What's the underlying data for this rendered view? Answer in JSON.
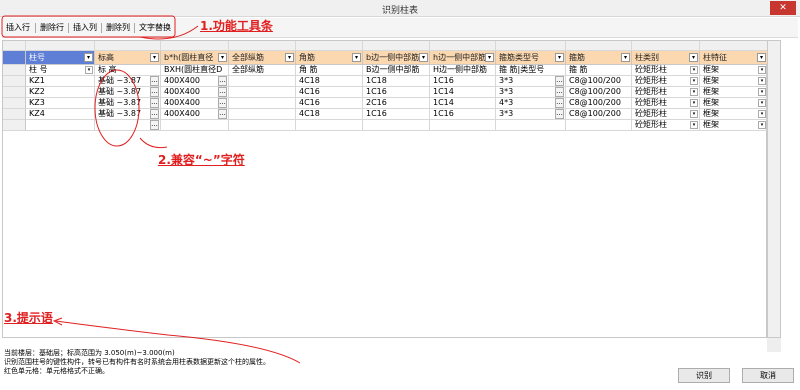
{
  "window": {
    "title": "识别柱表",
    "close_glyph": "✕"
  },
  "toolbar": {
    "insert_row": "插入行",
    "delete_row": "删除行",
    "insert_col": "插入列",
    "delete_col": "删除列",
    "text_replace": "文字替换"
  },
  "columns": [
    {
      "header": "柱号",
      "label": "柱 号"
    },
    {
      "header": "标高",
      "label": "标 高"
    },
    {
      "header": "b*h(圆柱直径",
      "label": "BXH(圆柱直径D"
    },
    {
      "header": "全部纵筋",
      "label": "全部纵筋"
    },
    {
      "header": "角筋",
      "label": "角 筋"
    },
    {
      "header": "b边一侧中部筋",
      "label": "B边一侧中部筋"
    },
    {
      "header": "h边一侧中部筋",
      "label": "H边一侧中部筋"
    },
    {
      "header": "箍筋类型号",
      "label": "箍 筋|类型号"
    },
    {
      "header": "箍筋",
      "label": "箍 筋"
    },
    {
      "header": "柱类别",
      "label": "砼矩形柱"
    },
    {
      "header": "柱特征",
      "label": "框架"
    }
  ],
  "rows": [
    [
      "KZ1",
      "基础 ~3.87",
      "400X400",
      "",
      "4C18",
      "1C18",
      "1C16",
      "3*3",
      "C8@100/200",
      "砼矩形柱",
      "框架"
    ],
    [
      "KZ2",
      "基础 ~3.87",
      "400X400",
      "",
      "4C16",
      "1C16",
      "1C14",
      "3*3",
      "C8@100/200",
      "砼矩形柱",
      "框架"
    ],
    [
      "KZ3",
      "基础 ~3.87",
      "400X400",
      "",
      "4C16",
      "2C16",
      "1C14",
      "4*3",
      "C8@100/200",
      "砼矩形柱",
      "框架"
    ],
    [
      "KZ4",
      "基础 ~3.87",
      "400X400",
      "",
      "4C18",
      "1C16",
      "1C16",
      "3*3",
      "C8@100/200",
      "砼矩形柱",
      "框架"
    ],
    [
      "",
      "",
      "",
      "",
      "",
      "",
      "",
      "",
      "",
      "砼矩形柱",
      "框架"
    ]
  ],
  "status": {
    "line1": "当前楼层：基础层；标高范围为 3.050(m)~3.000(m)",
    "line2": "识别范围柱号的键性构件，转号已有构件有名时系统会用柱表数据更新这个柱的属性。",
    "line3": "红色单元格：单元格格式不正确。"
  },
  "buttons": {
    "recognize": "识别",
    "cancel": "取消"
  },
  "annotations": {
    "a1": "1.功能工具条",
    "a2": "2.兼容“~”字符",
    "a3": "3.提示语"
  },
  "colors": {
    "header_bg": "#fbd8b0",
    "selected": "#5f7fd6",
    "annotation": "#e02020",
    "close": "#c7372f"
  }
}
